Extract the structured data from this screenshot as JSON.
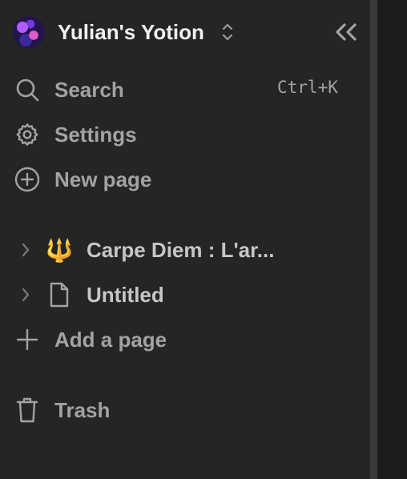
{
  "workspace": {
    "name": "Yulian's Yotion"
  },
  "menu": {
    "search": {
      "label": "Search",
      "shortcut": "Ctrl+K",
      "icon": "search-icon"
    },
    "settings": {
      "label": "Settings",
      "icon": "gear-icon"
    },
    "new_page": {
      "label": "New page",
      "icon": "plus-circle-icon"
    }
  },
  "pages": [
    {
      "title": "Carpe Diem : L'ar...",
      "icon": "trident-emoji",
      "emoji": "🔱"
    },
    {
      "title": "Untitled",
      "icon": "document-icon"
    }
  ],
  "add_page": {
    "label": "Add a page",
    "icon": "plus-icon"
  },
  "trash": {
    "label": "Trash",
    "icon": "trash-icon"
  },
  "colors": {
    "sidebar_bg": "#252525",
    "divider": "#3a3a3a",
    "main_bg": "#1c1c1c",
    "text_primary": "#f1f1f1",
    "text_muted": "#a3a3a3"
  }
}
